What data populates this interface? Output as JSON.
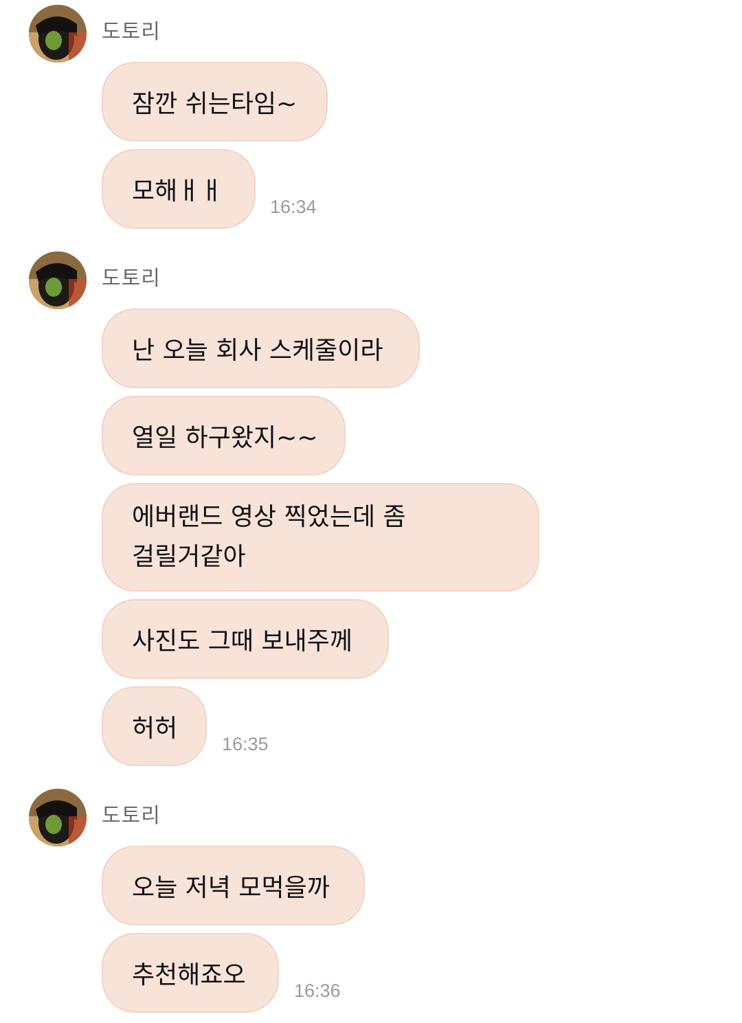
{
  "groups": [
    {
      "sender": "도토리",
      "messages": [
        "잠깐 쉬는타임~",
        "모해ㅐㅐ"
      ],
      "time": "16:34"
    },
    {
      "sender": "도토리",
      "messages": [
        "난 오늘 회사 스케줄이라",
        "열일 하구왔지~~",
        "에버랜드 영상 찍었는데 좀 걸릴거같아",
        "사진도 그때 보내주께",
        "허허"
      ],
      "time": "16:35"
    },
    {
      "sender": "도토리",
      "messages": [
        "오늘 저녁 모먹을까",
        "추천해죠오"
      ],
      "time": "16:36"
    }
  ]
}
